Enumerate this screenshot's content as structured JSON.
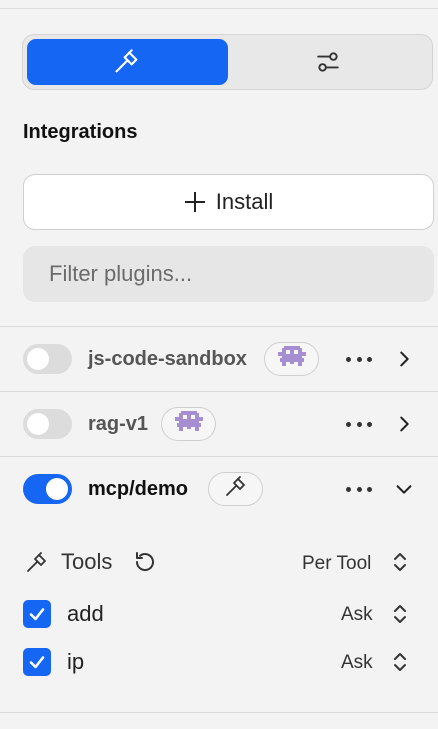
{
  "sidebar": {
    "tabs": [
      {
        "icon": "hammer-icon",
        "active": true
      },
      {
        "icon": "sliders-icon",
        "active": false
      }
    ],
    "section_title": "Integrations",
    "install_label": "Install",
    "filter_placeholder": "Filter plugins...",
    "plugins": [
      {
        "name": "js-code-sandbox",
        "enabled": false,
        "badge_icon": "robot-icon",
        "expanded": false
      },
      {
        "name": "rag-v1",
        "enabled": false,
        "badge_icon": "robot-icon",
        "expanded": false
      },
      {
        "name": "mcp/demo",
        "enabled": true,
        "badge_icon": "hammer-icon",
        "expanded": true
      }
    ],
    "tools_panel": {
      "title": "Tools",
      "permission_mode": "Per Tool",
      "tools": [
        {
          "name": "add",
          "checked": true,
          "permission": "Ask"
        },
        {
          "name": "ip",
          "checked": true,
          "permission": "Ask"
        }
      ]
    }
  },
  "colors": {
    "accent": "#1566f3",
    "background": "#f3f3f3",
    "robot_badge": "#a68fd0"
  }
}
